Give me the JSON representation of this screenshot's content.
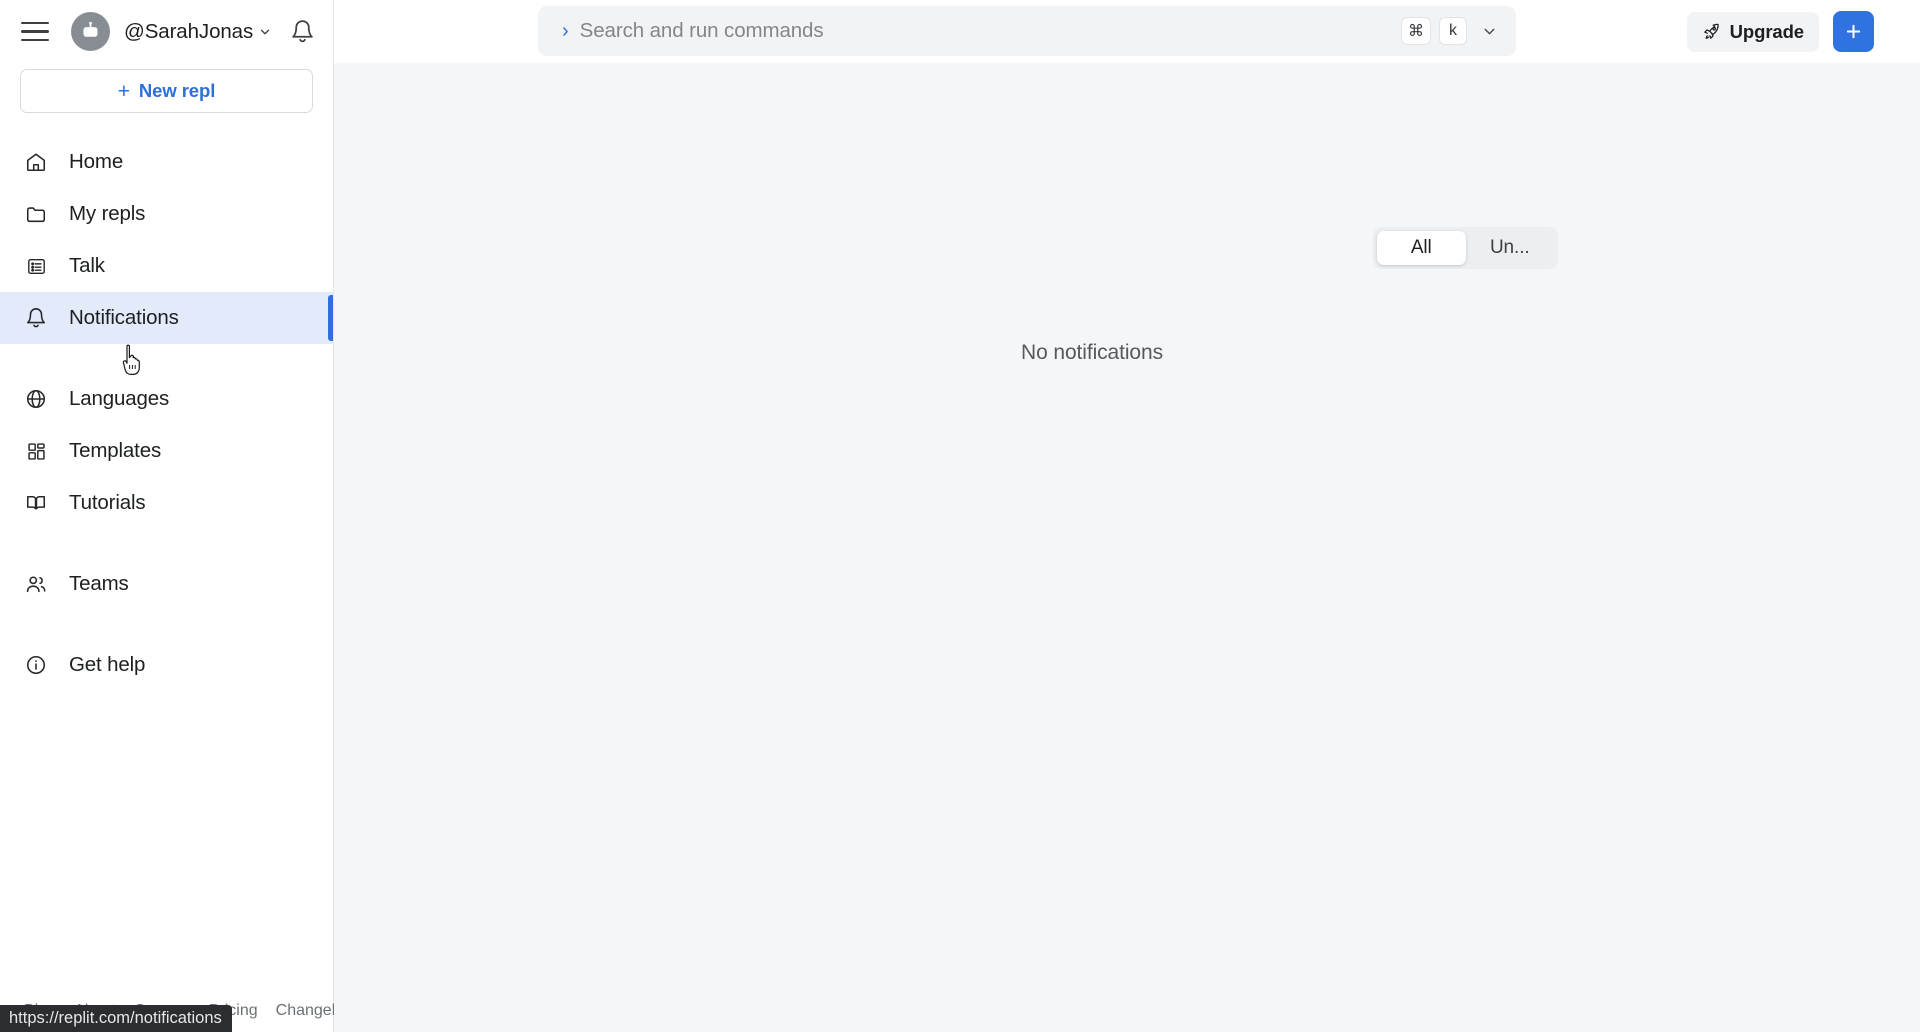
{
  "sidebar": {
    "hamburger_label": "menu",
    "username": "@SarahJonas",
    "new_repl_label": "New repl",
    "new_repl_plus": "+",
    "items": [
      {
        "label": "Home",
        "icon": "home-icon",
        "active": false
      },
      {
        "label": "My repls",
        "icon": "folder-icon",
        "active": false
      },
      {
        "label": "Talk",
        "icon": "list-icon",
        "active": false
      },
      {
        "label": "Notifications",
        "icon": "bell-icon",
        "active": true
      },
      {
        "label": "Languages",
        "icon": "globe-icon",
        "active": false
      },
      {
        "label": "Templates",
        "icon": "grid-icon",
        "active": false
      },
      {
        "label": "Tutorials",
        "icon": "book-icon",
        "active": false
      },
      {
        "label": "Teams",
        "icon": "users-icon",
        "active": false
      },
      {
        "label": "Get help",
        "icon": "info-icon",
        "active": false
      }
    ],
    "footer_links": [
      "Blog",
      "About",
      "Careers",
      "Pricing",
      "Changelog"
    ]
  },
  "topbar": {
    "search": {
      "prompt": "›",
      "placeholder": "Search and run commands",
      "key_cmd": "⌘",
      "key_k": "k"
    },
    "upgrade_label": "Upgrade",
    "new_button_label": "+"
  },
  "content": {
    "tabs": [
      {
        "label": "All",
        "selected": true
      },
      {
        "label": "Un...",
        "selected": false
      }
    ],
    "empty_message": "No notifications"
  },
  "statusbar": {
    "url": "https://replit.com/notifications"
  },
  "colors": {
    "accent": "#2f6fdd",
    "active_bg": "#e3ebfa",
    "page_bg": "#f5f6f7",
    "status_bg": "#2c2d30"
  }
}
